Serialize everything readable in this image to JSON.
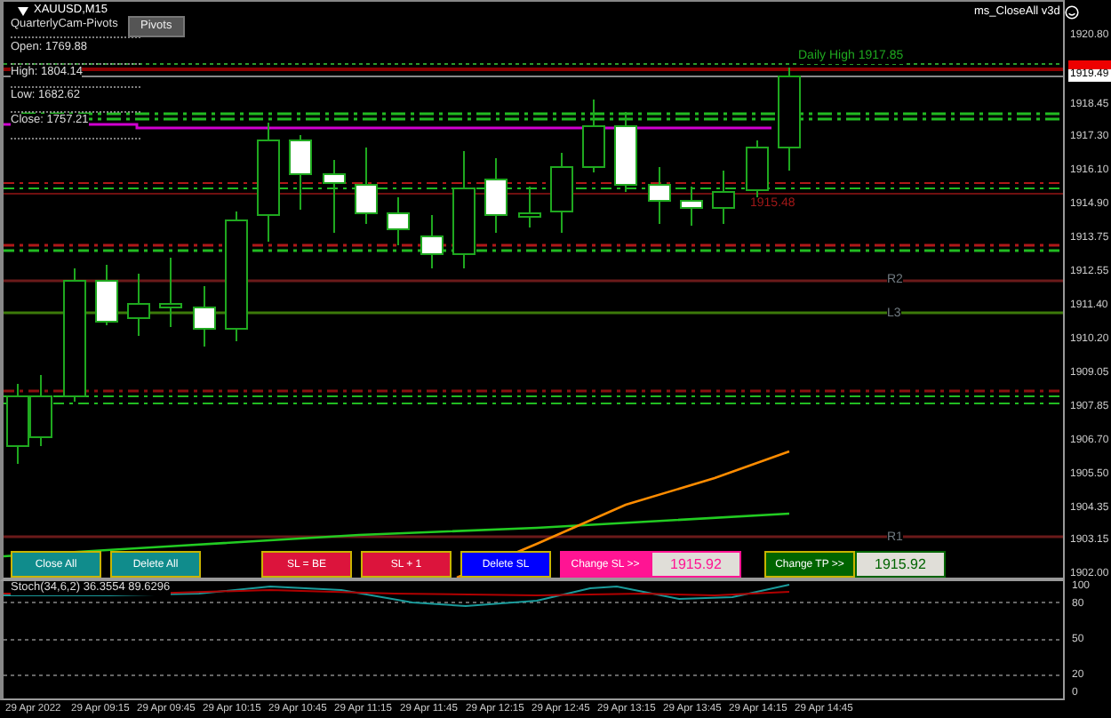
{
  "chart": {
    "symbol": "XAUUSD,M15",
    "indicator": "QuarterlyCam-Pivots",
    "indicator_button": "Pivots",
    "expert": "ms_CloseAll v3d",
    "info": [
      "Open: 1769.88",
      "High: 1804.14",
      "Low: 1682.62",
      "Close: 1757.21"
    ],
    "levels": [
      {
        "text": "Daily High 1917.85",
        "color": "#1fa81f"
      },
      {
        "text": "1915.48",
        "color": "#a01818"
      },
      {
        "text": "R2",
        "color": "#707a80"
      },
      {
        "text": "L3",
        "color": "#707a80"
      },
      {
        "text": "R1",
        "color": "#707a80"
      }
    ]
  },
  "price_axis": [
    {
      "text": "1920.80",
      "kind": "tick"
    },
    {
      "text": "1919.49",
      "kind": "current"
    },
    {
      "text": "1918.45",
      "kind": "tick"
    },
    {
      "text": "1917.30",
      "kind": "tick"
    },
    {
      "text": "1916.10",
      "kind": "tick"
    },
    {
      "text": "1914.90",
      "kind": "tick"
    },
    {
      "text": "1913.75",
      "kind": "tick"
    },
    {
      "text": "1912.55",
      "kind": "tick"
    },
    {
      "text": "1911.40",
      "kind": "tick"
    },
    {
      "text": "1910.20",
      "kind": "tick"
    },
    {
      "text": "1909.05",
      "kind": "tick"
    },
    {
      "text": "1907.85",
      "kind": "tick"
    },
    {
      "text": "1906.70",
      "kind": "tick"
    },
    {
      "text": "1905.50",
      "kind": "tick"
    },
    {
      "text": "1904.35",
      "kind": "tick"
    },
    {
      "text": "1903.15",
      "kind": "tick"
    },
    {
      "text": "1902.00",
      "kind": "tick"
    }
  ],
  "controls": [
    {
      "kind": "button",
      "label": "Close All",
      "color": "#108c8c"
    },
    {
      "kind": "button",
      "label": "Delete All",
      "color": "#108c8c"
    },
    {
      "kind": "button",
      "label": "SL = BE",
      "color": "#dc143c"
    },
    {
      "kind": "button",
      "label": "SL + 1",
      "color": "#dc143c"
    },
    {
      "kind": "button",
      "label": "Delete SL",
      "color": "#0000ff"
    },
    {
      "kind": "button",
      "label": "Change SL >>",
      "color": "#ff1493"
    },
    {
      "kind": "field",
      "value": "1915.92",
      "color": "#ff1493"
    },
    {
      "kind": "button",
      "label": "Change TP >>",
      "color": "#006400"
    },
    {
      "kind": "field",
      "value": "1915.92",
      "color": "#006400"
    }
  ],
  "stochastic": {
    "label": "Stoch(34,6,2) 36.3554 89.6296",
    "axis": [
      "100",
      "80",
      "50",
      "20",
      "0"
    ]
  },
  "time_axis": [
    "29 Apr 2022",
    "29 Apr 09:15",
    "29 Apr 09:45",
    "29 Apr 10:15",
    "29 Apr 10:45",
    "29 Apr 11:15",
    "29 Apr 11:45",
    "29 Apr 12:15",
    "29 Apr 12:45",
    "29 Apr 13:15",
    "29 Apr 13:45",
    "29 Apr 14:15",
    "29 Apr 14:45"
  ]
}
